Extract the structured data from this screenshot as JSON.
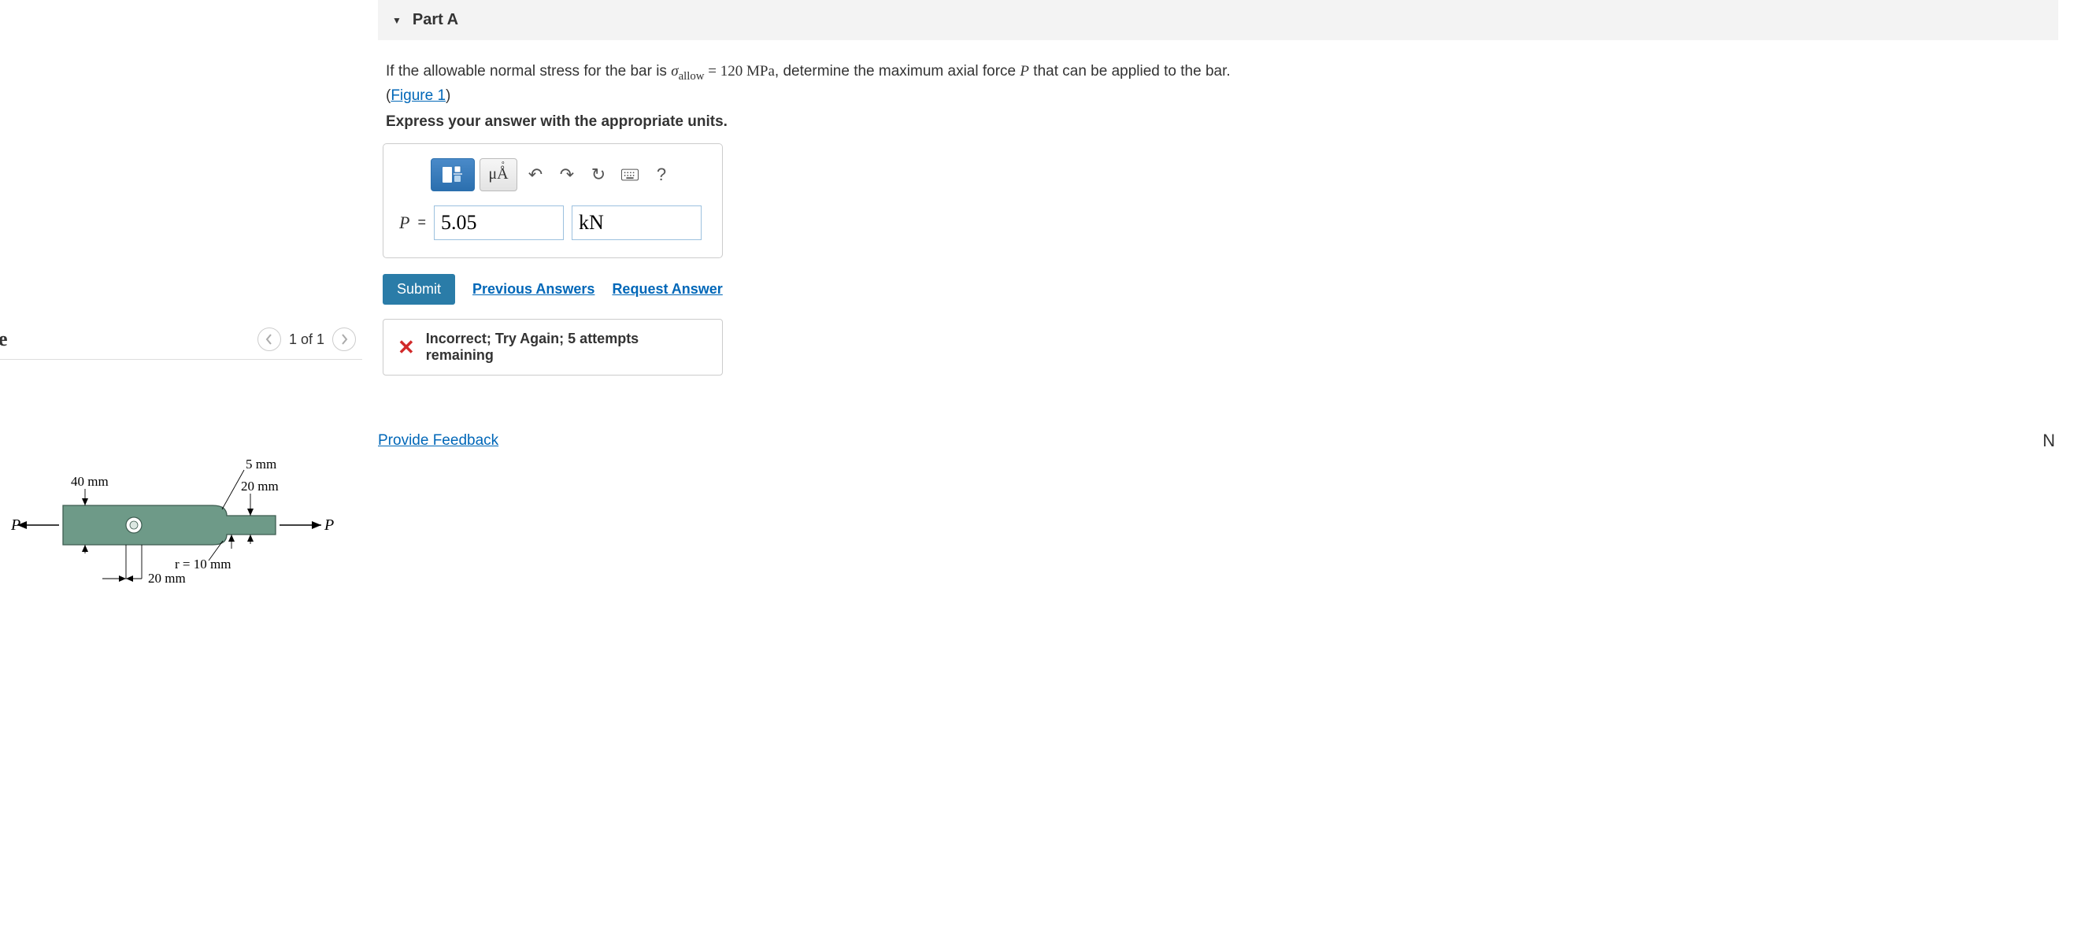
{
  "left": {
    "header_letter": "e",
    "figure_count": "1 of 1",
    "dims": {
      "top_left": "40 mm",
      "fillet": "5 mm",
      "small_h": "20 mm",
      "radius": "r = 10 mm",
      "hole_offset": "20 mm",
      "P_left": "P",
      "P_right": "P"
    }
  },
  "part": {
    "label": "Part A"
  },
  "problem": {
    "pre": "If the allowable normal stress for the bar is ",
    "sigma": "σ",
    "sigma_sub": "allow",
    "eq": " = ",
    "val": "120 MPa",
    "post": ", determine the maximum axial force ",
    "Pvar": "P",
    "post2": " that can be applied to the bar.",
    "figure_link": "Figure 1",
    "instruction": "Express your answer with the appropriate units."
  },
  "toolbar": {
    "units_btn": "μÅ",
    "help": "?"
  },
  "answer": {
    "var": "P",
    "eq": "=",
    "value": "5.05",
    "unit": "kN"
  },
  "actions": {
    "submit": "Submit",
    "prev": "Previous Answers",
    "request": "Request Answer"
  },
  "feedback": {
    "text": "Incorrect; Try Again; 5 attempts remaining"
  },
  "footer": {
    "provide": "Provide Feedback",
    "right_letter": "N"
  }
}
